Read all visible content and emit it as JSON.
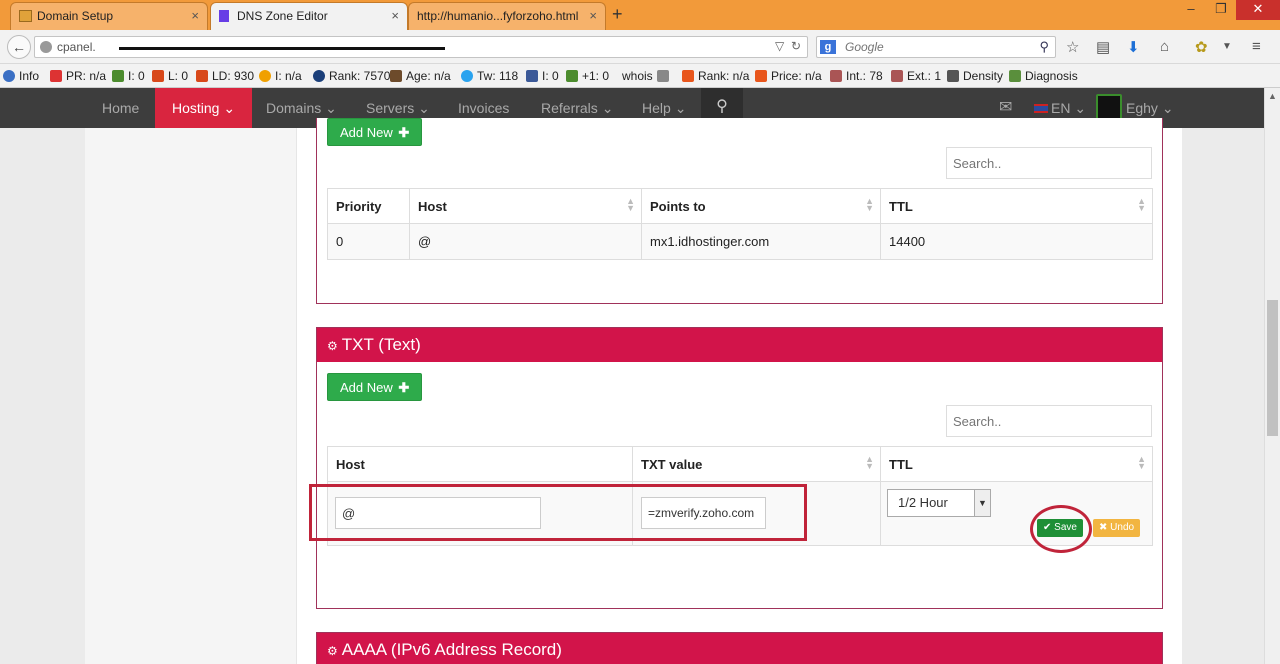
{
  "browser": {
    "tabs": [
      {
        "title": "Domain Setup"
      },
      {
        "title": "DNS Zone Editor"
      },
      {
        "title": "http://humanio...fyforzoho.html"
      }
    ],
    "url_text": "cpanel.",
    "search_placeholder": "Google",
    "addons": [
      {
        "label": "Info"
      },
      {
        "label": "PR: n/a"
      },
      {
        "label": "I: 0"
      },
      {
        "label": "L: 0"
      },
      {
        "label": "LD: 930"
      },
      {
        "label": "I: n/a"
      },
      {
        "label": "Rank: 7570"
      },
      {
        "label": "Age: n/a"
      },
      {
        "label": "Tw: 118"
      },
      {
        "label": "I: 0"
      },
      {
        "label": "+1: 0"
      },
      {
        "label": "whois"
      },
      {
        "label": "Rank: n/a"
      },
      {
        "label": "Price: n/a"
      },
      {
        "label": "Int.: 78"
      },
      {
        "label": "Ext.: 1"
      },
      {
        "label": "Density"
      },
      {
        "label": "Diagnosis"
      }
    ]
  },
  "site_nav": {
    "items": [
      "Home",
      "Hosting",
      "Domains",
      "Servers",
      "Invoices",
      "Referrals",
      "Help"
    ],
    "language": "EN",
    "user": "Eghy"
  },
  "mx_section": {
    "add_new_label": "Add New",
    "search_placeholder": "Search..",
    "columns": [
      "Priority",
      "Host",
      "Points to",
      "TTL"
    ],
    "rows": [
      {
        "priority": "0",
        "host": "@",
        "points_to": "mx1.idhostinger.com",
        "ttl": "14400"
      }
    ]
  },
  "txt_section": {
    "title": "TXT (Text)",
    "add_new_label": "Add New",
    "search_placeholder": "Search..",
    "columns": [
      "Host",
      "TXT value",
      "TTL"
    ],
    "edit_row": {
      "host_value": "@",
      "txt_value": "=zmverify.zoho.com",
      "ttl_selected": "1/2 Hour",
      "save_label": "Save",
      "undo_label": "Undo"
    }
  },
  "aaaa_section": {
    "title": "AAAA (IPv6 Address Record)"
  },
  "colors": {
    "panel_header": "#d2144a",
    "nav_active": "#d9253f",
    "add_button": "#2eab4b",
    "annotation": "#c0243a"
  }
}
